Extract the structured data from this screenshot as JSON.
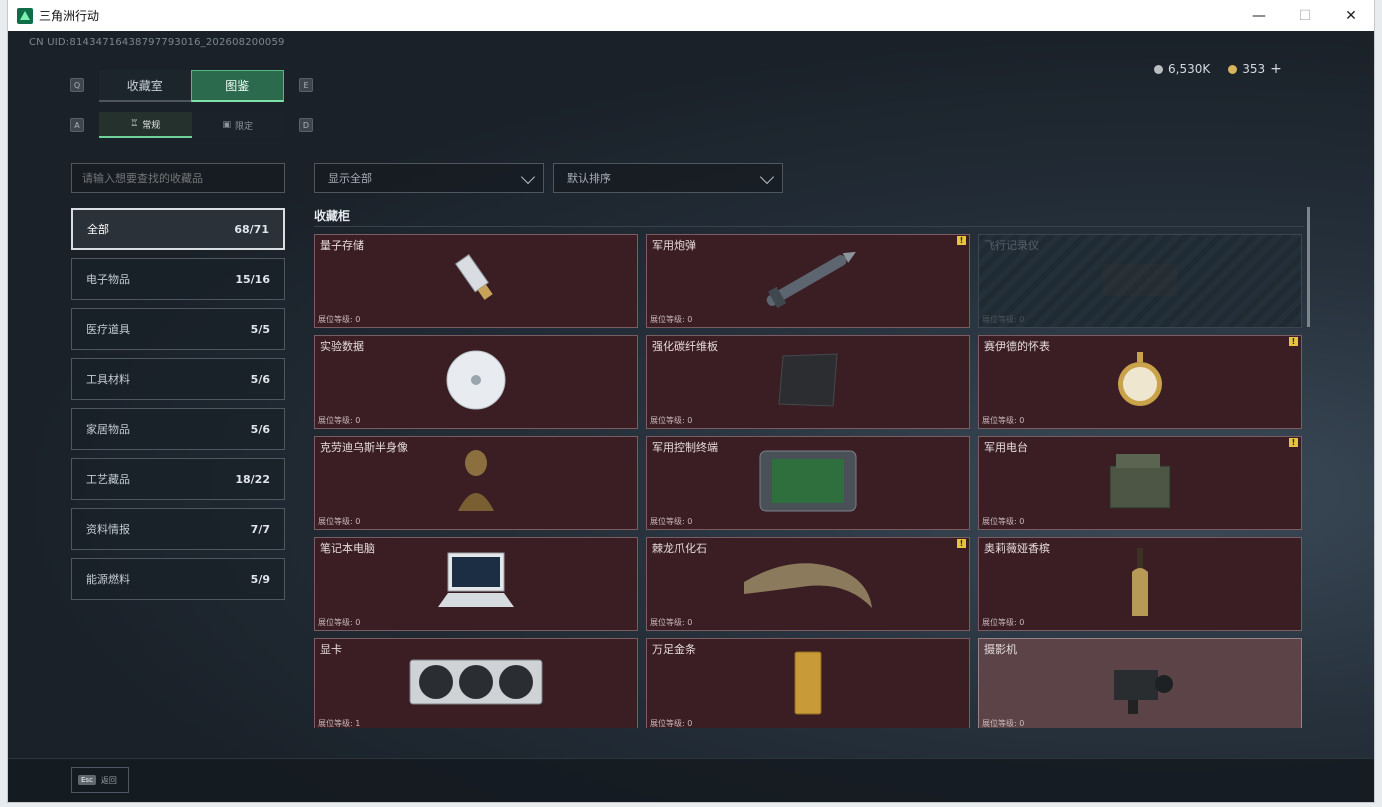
{
  "window": {
    "title": "三角洲行动"
  },
  "uid": "CN UID:81434716438797793016_202608200059",
  "tabs": {
    "left_key": "Q",
    "right_key": "E",
    "items": [
      "收藏室",
      "图鉴"
    ],
    "active": 1
  },
  "subtabs": {
    "left_key": "A",
    "right_key": "D",
    "items": [
      "常规",
      "限定"
    ],
    "active": 0
  },
  "currency": {
    "silver": "6,530K",
    "gold": "353",
    "add_label": "+"
  },
  "search": {
    "placeholder": "请输入想要查找的收藏品"
  },
  "filters": {
    "show": "显示全部",
    "sort": "默认排序"
  },
  "categories": [
    {
      "label": "全部",
      "count": "68/71"
    },
    {
      "label": "电子物品",
      "count": "15/16"
    },
    {
      "label": "医疗道具",
      "count": "5/5"
    },
    {
      "label": "工具材料",
      "count": "5/6"
    },
    {
      "label": "家居物品",
      "count": "5/6"
    },
    {
      "label": "工艺藏品",
      "count": "18/22"
    },
    {
      "label": "资料情报",
      "count": "7/7"
    },
    {
      "label": "能源燃料",
      "count": "5/9"
    }
  ],
  "section_title": "收藏柜",
  "level_label": "展位等级",
  "items": [
    {
      "name": "量子存储",
      "level": "展位等级: 0",
      "warn": false,
      "style": "normal",
      "icon": "usb-drive-icon"
    },
    {
      "name": "军用炮弹",
      "level": "展位等级: 0",
      "warn": true,
      "style": "normal",
      "icon": "missile-icon"
    },
    {
      "name": "飞行记录仪",
      "level": "展位等级: 0",
      "warn": false,
      "style": "dim",
      "icon": "flight-recorder-icon"
    },
    {
      "name": "实验数据",
      "level": "展位等级: 0",
      "warn": false,
      "style": "normal",
      "icon": "disc-icon"
    },
    {
      "name": "强化碳纤维板",
      "level": "展位等级: 0",
      "warn": false,
      "style": "normal",
      "icon": "carbon-plate-icon"
    },
    {
      "name": "赛伊德的怀表",
      "level": "展位等级: 0",
      "warn": true,
      "style": "normal",
      "icon": "pocket-watch-icon"
    },
    {
      "name": "克劳迪乌斯半身像",
      "level": "展位等级: 0",
      "warn": false,
      "style": "normal",
      "icon": "bust-icon"
    },
    {
      "name": "军用控制终端",
      "level": "展位等级: 0",
      "warn": false,
      "style": "normal",
      "icon": "terminal-icon"
    },
    {
      "name": "军用电台",
      "level": "展位等级: 0",
      "warn": true,
      "style": "normal",
      "icon": "radio-icon"
    },
    {
      "name": "笔记本电脑",
      "level": "展位等级: 0",
      "warn": false,
      "style": "normal",
      "icon": "laptop-icon"
    },
    {
      "name": "棘龙爪化石",
      "level": "展位等级: 0",
      "warn": true,
      "style": "normal",
      "icon": "claw-fossil-icon"
    },
    {
      "name": "奥莉薇娅香槟",
      "level": "展位等级: 0",
      "warn": false,
      "style": "normal",
      "icon": "champagne-icon"
    },
    {
      "name": "显卡",
      "level": "展位等级: 1",
      "warn": false,
      "style": "normal",
      "icon": "gpu-icon"
    },
    {
      "name": "万足金条",
      "level": "展位等级: 0",
      "warn": false,
      "style": "normal",
      "icon": "gold-bar-icon"
    },
    {
      "name": "摄影机",
      "level": "展位等级: 0",
      "warn": false,
      "style": "lite",
      "icon": "camera-icon"
    }
  ],
  "esc": {
    "key": "Esc",
    "label": "返回"
  }
}
